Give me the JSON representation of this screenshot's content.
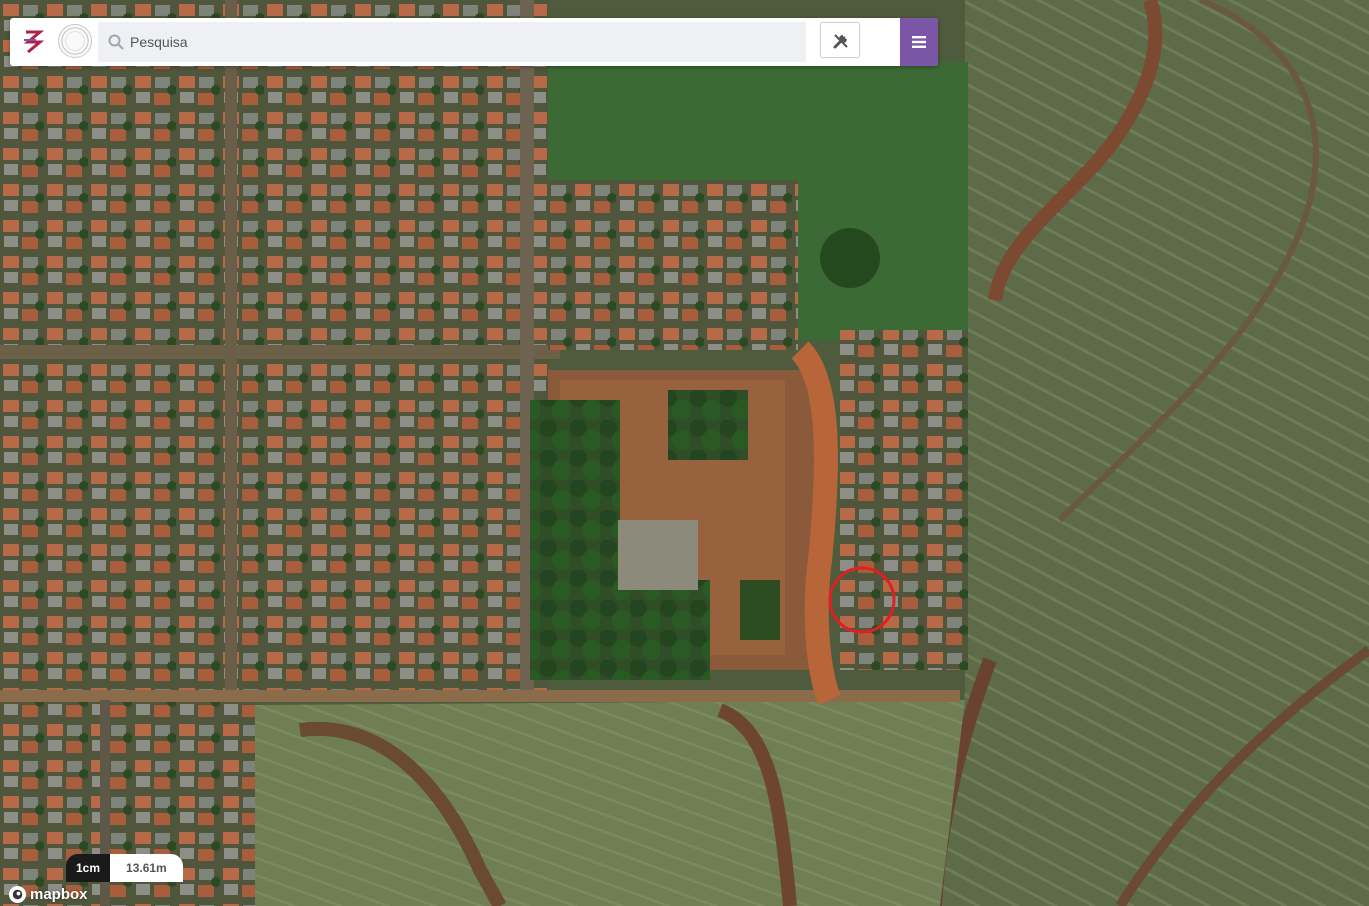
{
  "search": {
    "placeholder": "Pesquisa",
    "value": ""
  },
  "seal": {
    "text": "SÃO JOSÉ DO CAPOEIRAL"
  },
  "scale": {
    "unit": "1cm",
    "value": "13.61m"
  },
  "attribution": {
    "brand": "mapbox"
  },
  "marker": {
    "color": "#e02020"
  },
  "colors": {
    "accent": "#7b55a6",
    "logo": "#b2204a"
  },
  "icons": [
    "search-icon",
    "tools-icon",
    "menu-icon",
    "mapbox-icon"
  ]
}
